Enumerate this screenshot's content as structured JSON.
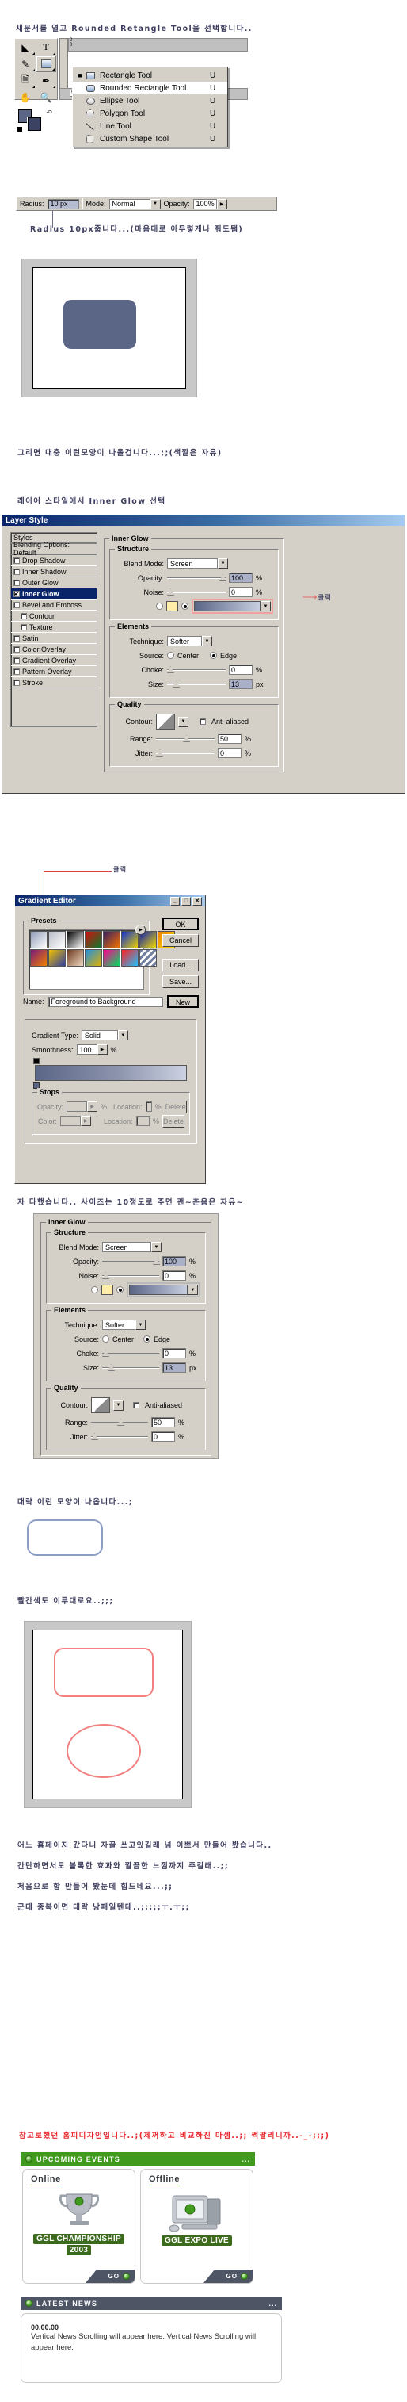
{
  "narration": {
    "step1": "새문서를 열고 Rounded Retangle Tool을 선택합니다..",
    "step2": "Radius 10px줍니다...(마음대로 아무렇게나 줘도됌)",
    "step3": "그리면 대충 이런모양이 나올겁니다...;;(색깔은 자유)",
    "step4": "레이어 스타일에서 Inner Glow 선택",
    "step5": "자 다했습니다.. 사이즈는 10정도로 주면 괜~춘음은 자유~",
    "step6": "대략 이런 모양이 나옵니다...;",
    "step7": "빨간색도 이루대로요..;;;",
    "step8": "어느 홈페이지 갔다니 자꿀 쓰고있길래 넘 이쁘서 만들어 봤습니다..",
    "step9": "간단하면서도 볼록한 효과와 깔끔한 느낌까지 주길래..;;",
    "step10": "처음으로 함 만들어 봤눈데 힘드네요...;;",
    "step11": "군데 중복이면 대략 낭패일텐데..;;;;;ㅜ.ㅜ;;",
    "step12": "참고로했던 홈피디자인입니다..;(제꺼하고 비교하진 마셈..;; 쩍팔리니까..-_-;;;)",
    "click_label_1": "클릭",
    "click_label_2": "클릭"
  },
  "toolbox": {
    "tools": [
      "move-tool",
      "type-tool",
      "pen-tool",
      "shape-tool",
      "notes-tool",
      "eyedropper-tool",
      "hand-tool",
      "zoom-tool"
    ],
    "ruler_origin": "0",
    "ruler_mark": "5"
  },
  "shape_flyout": {
    "items": [
      {
        "label": "Rectangle Tool",
        "key": "U",
        "icon": "rectangle-icon",
        "selected": true,
        "highlight": false
      },
      {
        "label": "Rounded Rectangle Tool",
        "key": "U",
        "icon": "rounded-rectangle-icon",
        "selected": false,
        "highlight": true
      },
      {
        "label": "Ellipse Tool",
        "key": "U",
        "icon": "ellipse-icon",
        "selected": false,
        "highlight": false
      },
      {
        "label": "Polygon Tool",
        "key": "U",
        "icon": "polygon-icon",
        "selected": false,
        "highlight": false
      },
      {
        "label": "Line Tool",
        "key": "U",
        "icon": "line-icon",
        "selected": false,
        "highlight": false
      },
      {
        "label": "Custom Shape Tool",
        "key": "U",
        "icon": "custom-shape-icon",
        "selected": false,
        "highlight": false
      }
    ]
  },
  "options_bar": {
    "radius_label": "Radius:",
    "radius_value": "10 px",
    "mode_label": "Mode:",
    "mode_value": "Normal",
    "opacity_label": "Opacity:",
    "opacity_value": "100%"
  },
  "layer_style": {
    "title": "Layer Style",
    "titlebar_buttons": [
      "minimize",
      "maximize",
      "close"
    ],
    "styles_header": "Styles",
    "blending_options": "Blending Options: Default",
    "effects": [
      {
        "label": "Drop Shadow",
        "checked": false,
        "selected": false,
        "indent": 0
      },
      {
        "label": "Inner Shadow",
        "checked": false,
        "selected": false,
        "indent": 0
      },
      {
        "label": "Outer Glow",
        "checked": false,
        "selected": false,
        "indent": 0
      },
      {
        "label": "Inner Glow",
        "checked": true,
        "selected": true,
        "indent": 0
      },
      {
        "label": "Bevel and Emboss",
        "checked": false,
        "selected": false,
        "indent": 0
      },
      {
        "label": "Contour",
        "checked": false,
        "selected": false,
        "indent": 1
      },
      {
        "label": "Texture",
        "checked": false,
        "selected": false,
        "indent": 1
      },
      {
        "label": "Satin",
        "checked": false,
        "selected": false,
        "indent": 0
      },
      {
        "label": "Color Overlay",
        "checked": false,
        "selected": false,
        "indent": 0
      },
      {
        "label": "Gradient Overlay",
        "checked": false,
        "selected": false,
        "indent": 0
      },
      {
        "label": "Pattern Overlay",
        "checked": false,
        "selected": false,
        "indent": 0
      },
      {
        "label": "Stroke",
        "checked": false,
        "selected": false,
        "indent": 0
      }
    ],
    "panel_title": "Inner Glow",
    "structure": {
      "legend": "Structure",
      "blend_mode_label": "Blend Mode:",
      "blend_mode_value": "Screen",
      "opacity_label": "Opacity:",
      "opacity_value": "100",
      "opacity_unit": "%",
      "noise_label": "Noise:",
      "noise_value": "0",
      "noise_unit": "%",
      "color_swatch": "#ffeeaa",
      "gradient_from": "#5b6586",
      "gradient_to": "#c7cee0"
    },
    "elements": {
      "legend": "Elements",
      "technique_label": "Technique:",
      "technique_value": "Softer",
      "source_label": "Source:",
      "source_center": "Center",
      "source_edge": "Edge",
      "source_selected": "Edge",
      "choke_label": "Choke:",
      "choke_value": "0",
      "choke_unit": "%",
      "size_label": "Size:",
      "size_value": "13",
      "size_unit": "px"
    },
    "quality": {
      "legend": "Quality",
      "contour_label": "Contour:",
      "antialiased_label": "Anti-aliased",
      "antialiased_checked": false,
      "range_label": "Range:",
      "range_value": "50",
      "range_unit": "%",
      "jitter_label": "Jitter:",
      "jitter_value": "0",
      "jitter_unit": "%"
    }
  },
  "layer_style_2": {
    "panel_title": "Inner Glow",
    "structure_legend": "Structure",
    "blend_mode_label": "Blend Mode:",
    "blend_mode_value": "Screen",
    "opacity_label": "Opacity:",
    "opacity_value": "100",
    "noise_label": "Noise:",
    "noise_value": "0",
    "elements_legend": "Elements",
    "technique_label": "Technique:",
    "technique_value": "Softer",
    "source_label": "Source:",
    "source_center": "Center",
    "source_edge": "Edge",
    "choke_label": "Choke:",
    "choke_value": "0",
    "size_label": "Size:",
    "size_value": "13",
    "size_unit": "px",
    "quality_legend": "Quality",
    "contour_label": "Contour:",
    "antialiased_label": "Anti-aliased",
    "range_label": "Range:",
    "range_value": "50",
    "jitter_label": "Jitter:",
    "jitter_value": "0",
    "pct": "%"
  },
  "gradient_editor": {
    "title": "Gradient Editor",
    "presets_legend": "Presets",
    "name_label": "Name:",
    "name_value": "Foreground to Background",
    "gradient_type_label": "Gradient Type:",
    "gradient_type_value": "Solid",
    "smoothness_label": "Smoothness:",
    "smoothness_value": "100",
    "smoothness_unit": "%",
    "stops_legend": "Stops",
    "opacity_label": "Opacity:",
    "opacity_unit": "%",
    "opacity_location_label": "Location:",
    "color_label": "Color:",
    "color_location_label": "Location:",
    "location_unit": "%",
    "delete_label": "Delete",
    "buttons": [
      "OK",
      "Cancel",
      "Load...",
      "Save...",
      "New"
    ],
    "preset_colors": [
      [
        "#8f9ab8",
        "#ffffff"
      ],
      [
        "#b8bcc8",
        "transparent"
      ],
      [
        "#000000",
        "#ffffff"
      ],
      [
        "#d01010",
        "#0a7a2a"
      ],
      [
        "#3a2060",
        "#f07000"
      ],
      [
        "#1030d0",
        "#e8d000"
      ],
      [
        "#1020b0",
        "#f0d800"
      ],
      [
        "#f08000",
        "#ffe000"
      ],
      [
        "#7a1a7a",
        "#f08000"
      ],
      [
        "#f0c000",
        "#3040a0"
      ],
      [
        "#6b3a20",
        "#f0d8c0"
      ],
      [
        "#2090e0",
        "#e0b000"
      ],
      [
        "#ff0090",
        "#00e060"
      ],
      [
        "#ff2020",
        "#20c0ff"
      ],
      [
        "#707f9f",
        "#ffffff"
      ]
    ]
  },
  "preview_plain": {
    "shape_color": "#5b6586",
    "caption_color": "#3e3e5e"
  },
  "preview_red": {
    "rect_stroke": "#f08080",
    "ellipse_stroke": "#f08080"
  },
  "ggl": {
    "upcoming_title": "UPCOMING EVENTS",
    "upcoming_more": "...",
    "header_bg": "#3f9a1e",
    "cards": [
      {
        "title": "Online",
        "badge_line1": "GGL CHAMPIONSHIP",
        "badge_line2": "2003",
        "go_label": "GO",
        "art": "trophy-icon"
      },
      {
        "title": "Offline",
        "badge_line1": "GGL EXPO LIVE",
        "badge_line2": "",
        "go_label": "GO",
        "art": "computer-icon"
      }
    ],
    "news_title": "LATEST NEWS",
    "news_more": "...",
    "news_header_bg": "#4e5666",
    "news_date": "00.00.00",
    "news_text": "Vertical News Scrolling will appear here. Vertical News Scrolling will appear here."
  }
}
